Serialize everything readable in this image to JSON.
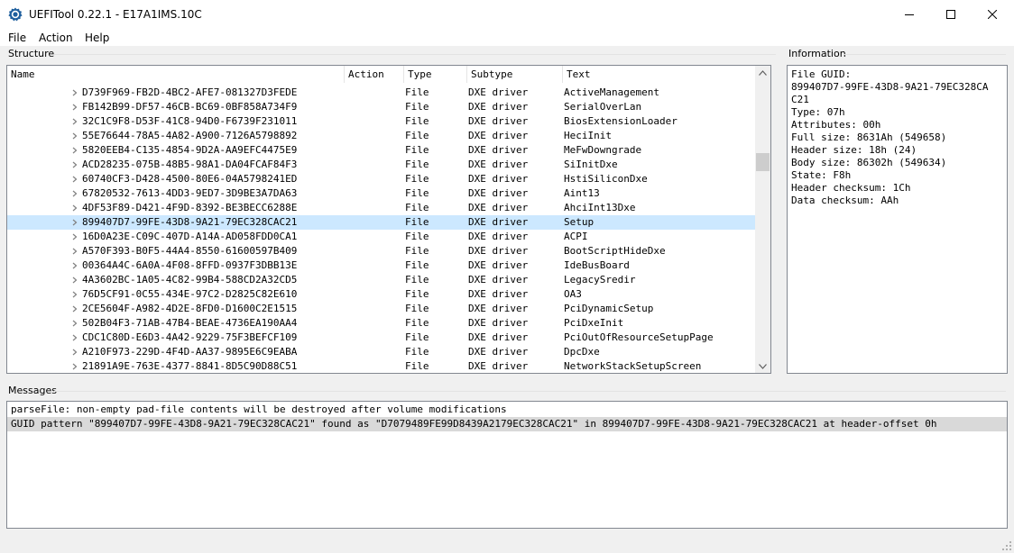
{
  "window": {
    "title": "UEFITool 0.22.1 - E17A1IMS.10C",
    "controls": [
      "minimize-icon",
      "maximize-icon",
      "close-icon"
    ]
  },
  "menu": [
    "File",
    "Action",
    "Help"
  ],
  "structure": {
    "label": "Structure",
    "columns": [
      "Name",
      "Action",
      "Type",
      "Subtype",
      "Text"
    ],
    "rows": [
      {
        "name": "D739F969-FB2D-4BC2-AFE7-081327D3FEDE",
        "action": "",
        "type": "File",
        "subtype": "DXE driver",
        "text": "ActiveManagement"
      },
      {
        "name": "FB142B99-DF57-46CB-BC69-0BF858A734F9",
        "action": "",
        "type": "File",
        "subtype": "DXE driver",
        "text": "SerialOverLan"
      },
      {
        "name": "32C1C9F8-D53F-41C8-94D0-F6739F231011",
        "action": "",
        "type": "File",
        "subtype": "DXE driver",
        "text": "BiosExtensionLoader"
      },
      {
        "name": "55E76644-78A5-4A82-A900-7126A5798892",
        "action": "",
        "type": "File",
        "subtype": "DXE driver",
        "text": "HeciInit"
      },
      {
        "name": "5820EEB4-C135-4854-9D2A-AA9EFC4475E9",
        "action": "",
        "type": "File",
        "subtype": "DXE driver",
        "text": "MeFwDowngrade"
      },
      {
        "name": "ACD28235-075B-48B5-98A1-DA04FCAF84F3",
        "action": "",
        "type": "File",
        "subtype": "DXE driver",
        "text": "SiInitDxe"
      },
      {
        "name": "60740CF3-D428-4500-80E6-04A5798241ED",
        "action": "",
        "type": "File",
        "subtype": "DXE driver",
        "text": "HstiSiliconDxe"
      },
      {
        "name": "67820532-7613-4DD3-9ED7-3D9BE3A7DA63",
        "action": "",
        "type": "File",
        "subtype": "DXE driver",
        "text": "Aint13"
      },
      {
        "name": "4DF53F89-D421-4F9D-8392-BE3BECC6288E",
        "action": "",
        "type": "File",
        "subtype": "DXE driver",
        "text": "AhciInt13Dxe"
      },
      {
        "name": "899407D7-99FE-43D8-9A21-79EC328CAC21",
        "action": "",
        "type": "File",
        "subtype": "DXE driver",
        "text": "Setup",
        "selected": true
      },
      {
        "name": "16D0A23E-C09C-407D-A14A-AD058FDD0CA1",
        "action": "",
        "type": "File",
        "subtype": "DXE driver",
        "text": "ACPI"
      },
      {
        "name": "A570F393-B0F5-44A4-8550-61600597B409",
        "action": "",
        "type": "File",
        "subtype": "DXE driver",
        "text": "BootScriptHideDxe"
      },
      {
        "name": "00364A4C-6A0A-4F08-8FFD-0937F3DBB13E",
        "action": "",
        "type": "File",
        "subtype": "DXE driver",
        "text": "IdeBusBoard"
      },
      {
        "name": "4A3602BC-1A05-4C82-99B4-588CD2A32CD5",
        "action": "",
        "type": "File",
        "subtype": "DXE driver",
        "text": "LegacySredir"
      },
      {
        "name": "76D5CF91-0C55-434E-97C2-D2825C82E610",
        "action": "",
        "type": "File",
        "subtype": "DXE driver",
        "text": "OA3"
      },
      {
        "name": "2CE5604F-A982-4D2E-8FD0-D1600C2E1515",
        "action": "",
        "type": "File",
        "subtype": "DXE driver",
        "text": "PciDynamicSetup"
      },
      {
        "name": "502B04F3-71AB-47B4-BEAE-4736EA190AA4",
        "action": "",
        "type": "File",
        "subtype": "DXE driver",
        "text": "PciDxeInit"
      },
      {
        "name": "CDC1C80D-E6D3-4A42-9229-75F3BEFCF109",
        "action": "",
        "type": "File",
        "subtype": "DXE driver",
        "text": "PciOutOfResourceSetupPage"
      },
      {
        "name": "A210F973-229D-4F4D-AA37-9895E6C9EABA",
        "action": "",
        "type": "File",
        "subtype": "DXE driver",
        "text": "DpcDxe"
      },
      {
        "name": "21891A9E-763E-4377-8841-8D5C90D88C51",
        "action": "",
        "type": "File",
        "subtype": "DXE driver",
        "text": "NetworkStackSetupScreen"
      }
    ]
  },
  "information": {
    "label": "Information",
    "lines": [
      "File GUID:",
      "899407D7-99FE-43D8-9A21-79EC328CA",
      "C21",
      "Type: 07h",
      "Attributes: 00h",
      "Full size: 8631Ah (549658)",
      "Header size: 18h (24)",
      "Body size: 86302h (549634)",
      "State: F8h",
      "Header checksum: 1Ch",
      "Data checksum: AAh"
    ]
  },
  "messages": {
    "label": "Messages",
    "lines": [
      "parseFile: non-empty pad-file contents will be destroyed after volume modifications",
      "GUID pattern \"899407D7-99FE-43D8-9A21-79EC328CAC21\" found as \"D7079489FE99D8439A2179EC328CAC21\" in 899407D7-99FE-43D8-9A21-79EC328CAC21 at header-offset 0h"
    ],
    "selected_index": 1
  },
  "colors": {
    "selection": "#cce8ff",
    "message_selection": "#d9d9d9",
    "border": "#828790",
    "window_bg": "#f0f0f0"
  }
}
